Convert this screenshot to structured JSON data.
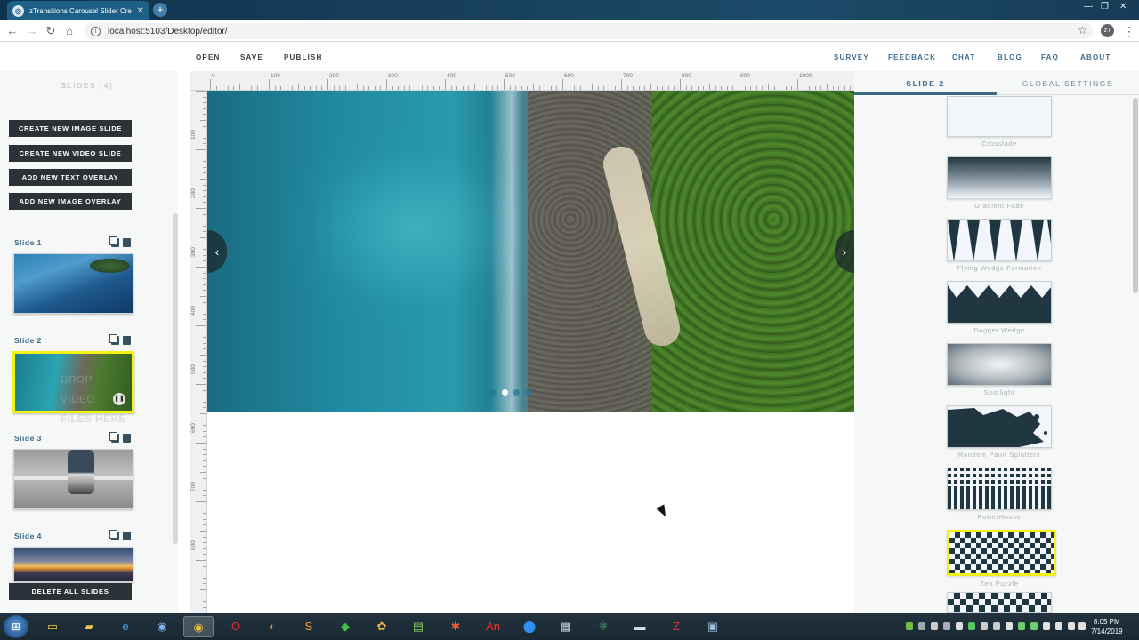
{
  "browser": {
    "tab_title": "zTransitions Carousel Slider Crea",
    "url": "localhost:5103/Desktop/editor/",
    "profile_initials": "zT"
  },
  "appnav": {
    "left": [
      "OPEN",
      "SAVE",
      "PUBLISH"
    ],
    "right": [
      "SURVEY",
      "FEEDBACK",
      "CHAT",
      "BLOG",
      "FAQ",
      "ABOUT"
    ]
  },
  "sidebar": {
    "title": "SLIDES (4)",
    "buttons": [
      "CREATE NEW IMAGE SLIDE",
      "CREATE NEW VIDEO SLIDE",
      "ADD NEW TEXT OVERLAY",
      "ADD NEW IMAGE OVERLAY"
    ],
    "slides": [
      {
        "label": "Slide 1"
      },
      {
        "label": "Slide 2"
      },
      {
        "label": "Slide 3"
      },
      {
        "label": "Slide 4"
      }
    ],
    "drop_text": [
      "DROP",
      "VIDEO",
      "FILES HERE"
    ],
    "delete_all": "DELETE ALL SLIDES"
  },
  "editor": {
    "ruler_top": [
      "0",
      "100",
      "200",
      "300",
      "400",
      "500",
      "600",
      "700",
      "800",
      "900",
      "1000"
    ],
    "ruler_left": [
      "100",
      "200",
      "300",
      "400",
      "500",
      "600",
      "700",
      "800"
    ],
    "carousel_prev_glyph": "‹",
    "carousel_next_glyph": "›"
  },
  "right_panel": {
    "tabs": [
      "SLIDE 2",
      "GLOBAL SETTINGS"
    ],
    "transitions": [
      "Crossfade",
      "Gradient Fade",
      "Flying Wedge Formation",
      "Dagger Wedge",
      "Spotlight",
      "Random Paint Splatters",
      "PowerHouse",
      "Zen Puzzle"
    ],
    "selected_transition": "Zen Puzzle"
  },
  "taskbar": {
    "time": "8:05 PM",
    "date": "7/14/2019",
    "apps": [
      "file-explorer-icon",
      "folder-icon",
      "internet-explorer-icon",
      "chrome-canary-icon",
      "chrome-icon",
      "opera-icon",
      "firefox-icon",
      "sublime-icon",
      "app-green-icon",
      "paint-icon",
      "notepad-icon",
      "app-orange-icon",
      "animate-icon",
      "maps-icon",
      "calculator-icon",
      "atom-icon",
      "terminal-icon",
      "filezilla-icon",
      "screenshot-icon"
    ]
  },
  "colors": {
    "accent": "#3a6887",
    "highlight": "#f2f213",
    "button_dark": "#2c3338",
    "transition_dark": "#203641"
  }
}
